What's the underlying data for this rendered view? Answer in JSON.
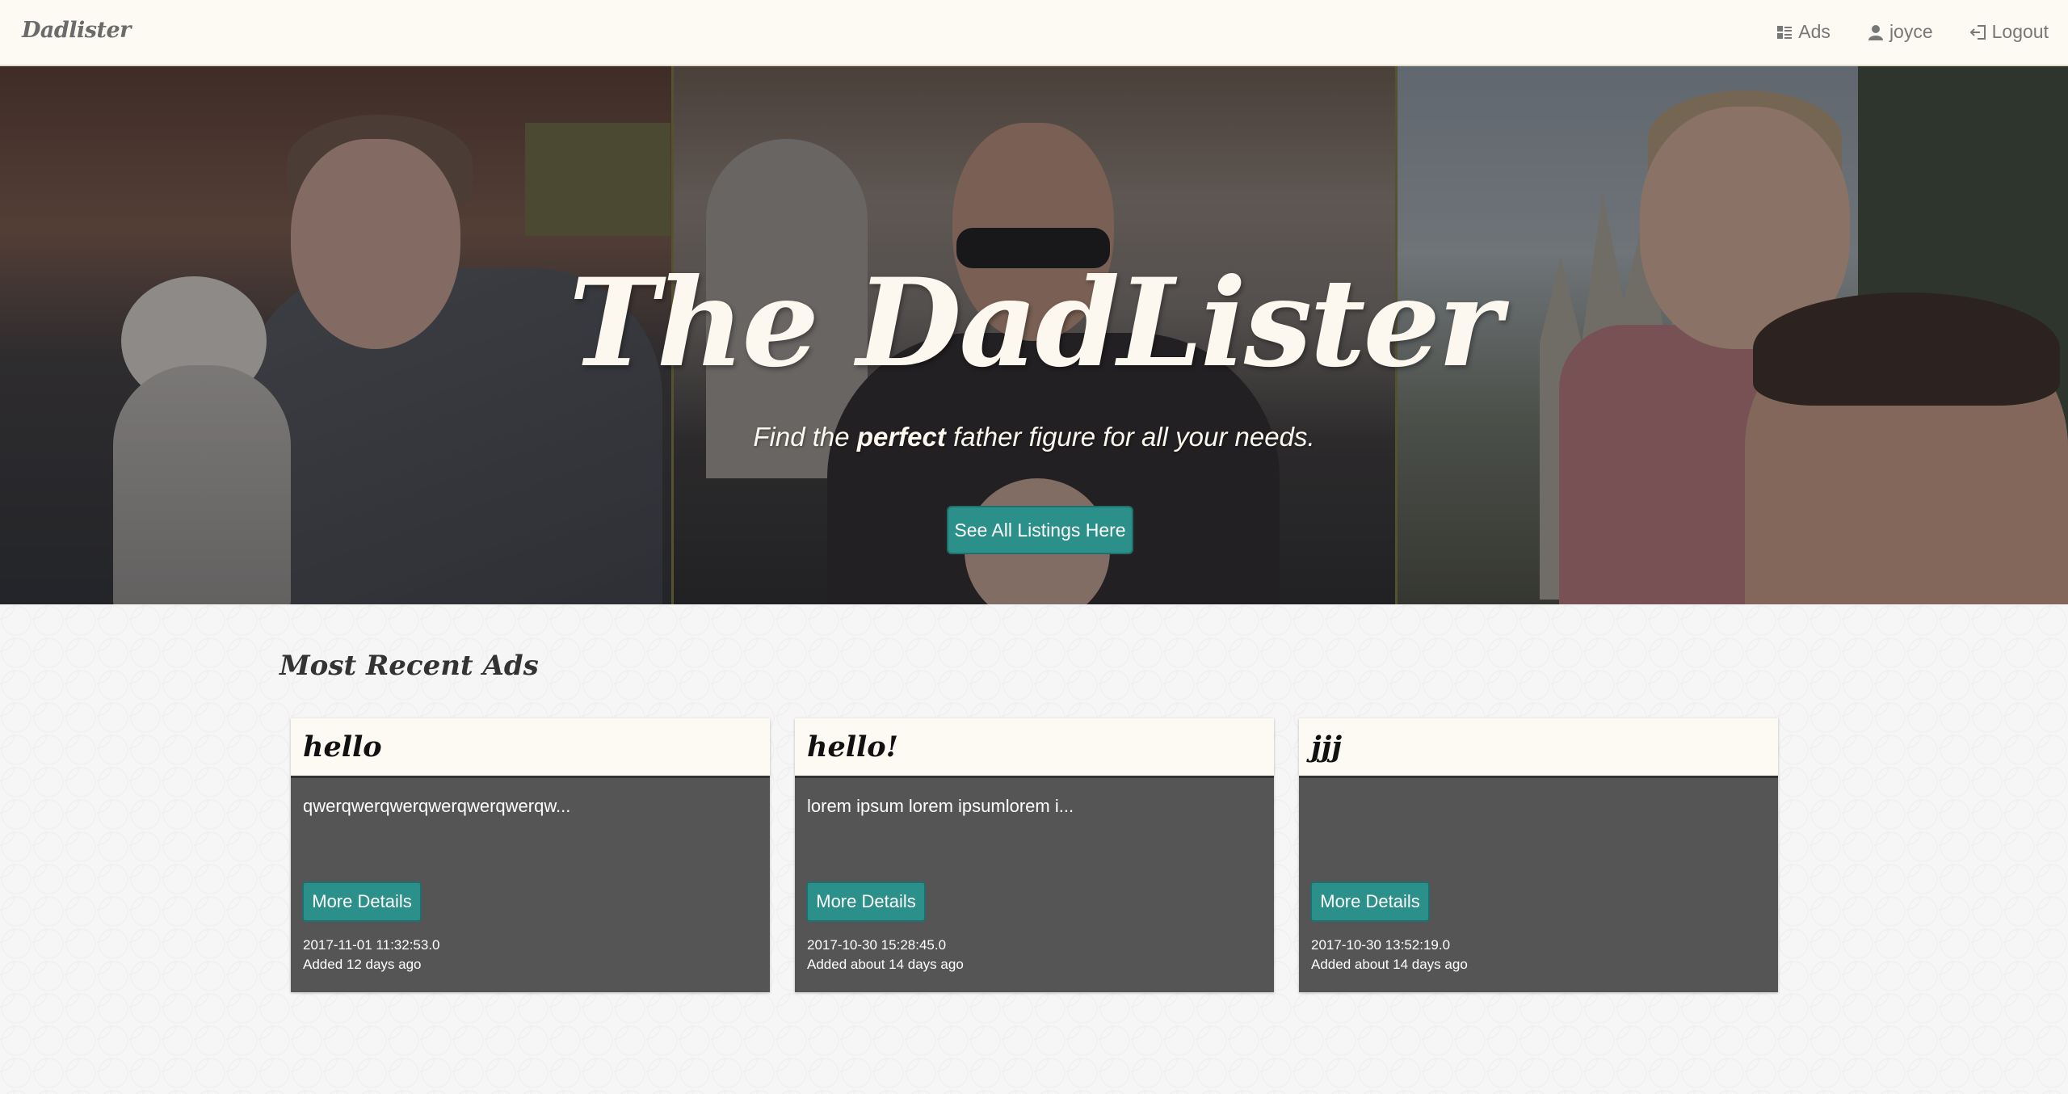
{
  "nav": {
    "brand": "Dadlister",
    "ads_label": "Ads",
    "user_label": "joyce",
    "logout_label": "Logout"
  },
  "hero": {
    "title": "The DadLister",
    "subtitle_pre": "Find the ",
    "subtitle_em": "perfect",
    "subtitle_post": " father figure for all your needs.",
    "button_label": "See All Listings Here"
  },
  "recent": {
    "title": "Most Recent Ads",
    "cards": [
      {
        "title": "hello",
        "description": "qwerqwerqwerqwerqwerqwerqw...",
        "button_label": "More Details",
        "date": "2017-11-01 11:32:53.0",
        "added": "Added 12 days ago"
      },
      {
        "title": "hello!",
        "description": "lorem ipsum lorem ipsumlorem i...",
        "button_label": "More Details",
        "date": "2017-10-30 15:28:45.0",
        "added": "Added about 14 days ago"
      },
      {
        "title": "jjj",
        "description": "",
        "button_label": "More Details",
        "date": "2017-10-30 13:52:19.0",
        "added": "Added about 14 days ago"
      }
    ]
  },
  "colors": {
    "navbar_bg": "#fdfaf3",
    "accent_teal": "#2b8f8a",
    "card_body": "#555555"
  }
}
